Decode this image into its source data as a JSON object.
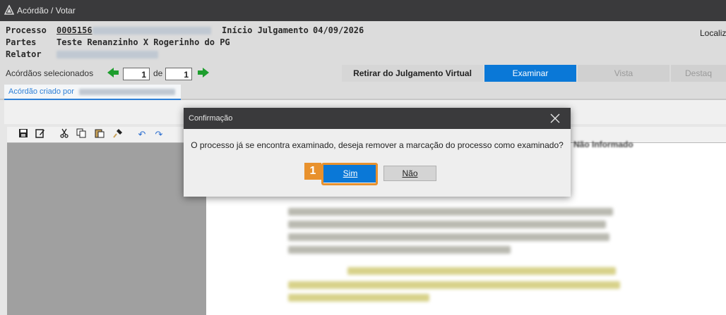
{
  "window": {
    "title": "Acórdão / Votar"
  },
  "header": {
    "processo_label": "Processo",
    "processo_value": "0005156",
    "inicio_label": "Início Julgamento",
    "inicio_value": "04/09/2026",
    "partes_label": "Partes",
    "partes_value": "Teste Renanzinho X Rogerinho do PG",
    "relator_label": "Relator",
    "localiz_label": "Localiz"
  },
  "nav": {
    "label": "Acórdãos selecionados",
    "current": "1",
    "of_label": "de",
    "total": "1"
  },
  "actions": {
    "retirar": "Retirar do Julgamento Virtual",
    "examinar": "Examinar",
    "vista": "Vista",
    "destaque": "Destaq"
  },
  "acordao_tab": {
    "label": "Acórdão criado por"
  },
  "document": {
    "header_fragment": "Não Informado"
  },
  "dialog": {
    "title": "Confirmação",
    "message": "O processo já se encontra examinado, deseja remover a marcação do processo como examinado?",
    "yes": "Sim",
    "no": "Não"
  },
  "callout": {
    "number": "1"
  },
  "colors": {
    "titlebar": "#3a3a3c",
    "primary_button": "#0a78d7",
    "highlight": "#e8912d",
    "nav_arrow": "#1e9e2e"
  },
  "icons": {
    "toolbar": [
      "save-icon",
      "edit-icon",
      "cut-icon",
      "copy-icon",
      "paste-icon",
      "format-painter-icon",
      "undo-icon",
      "redo-icon"
    ]
  }
}
